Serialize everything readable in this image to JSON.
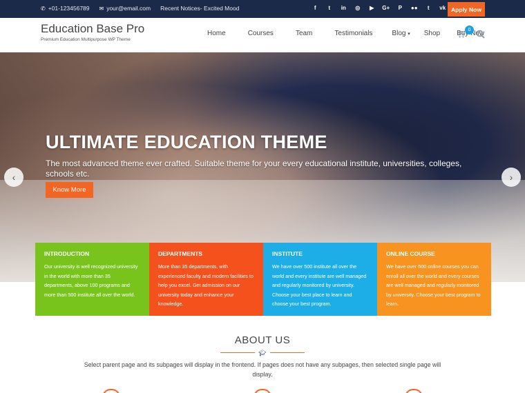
{
  "topbar": {
    "phone": "+01-123456789",
    "email": "your@email.com",
    "notice": "Recent Notices- Excited Mood",
    "social": [
      "facebook-icon",
      "twitter-icon",
      "linkedin-icon",
      "instagram-icon",
      "youtube-icon",
      "google-plus-icon",
      "pinterest-icon",
      "flickr-icon",
      "tumblr-icon",
      "vk-icon"
    ],
    "social_glyphs": [
      "f",
      "t",
      "in",
      "◎",
      "▶",
      "G+",
      "P",
      "●●",
      "t",
      "vk"
    ],
    "apply_label": "Apply Now",
    "colors": {
      "bg": "#1c2a4a",
      "accent": "#f26522"
    }
  },
  "header": {
    "site_title": "Education Base Pro",
    "tagline": "Premium Education Multipurpose WP Theme",
    "nav": [
      "Home",
      "Courses",
      "Team",
      "Testimonials",
      "Blog",
      "Shop",
      "Buy Now"
    ],
    "cart_count": "0"
  },
  "hero": {
    "heading": "ULTIMATE EDUCATION THEME",
    "subtitle": "The most advanced theme ever crafted. Suitable theme for your every educational institute, universities, colleges, schools etc.",
    "button": "Know More"
  },
  "cards": [
    {
      "title": "INTRODUCTION",
      "text": "Our university is well recognized university in the world with more than 35 departments, above 100 programs and more than 500 institute all over the world.",
      "color": "#78c41c"
    },
    {
      "title": "DEPARTMENTS",
      "text": "More than 35 departments, with experienced faculty and modern facilities to help you excel. Get admission on our university today and enhance your knowledge.",
      "color": "#f5511d"
    },
    {
      "title": "INSTITUTE",
      "text": "We have over 500 institute all over the world and every institute are well managed and regularly monitored by university. Choose your best place to learn and choose your best program.",
      "color": "#1daee8"
    },
    {
      "title": "ONLINE COURSE",
      "text": "We have over 500 online courses you can enroll all over the world and every courses are well managed and regularly monitored by university. Choose your best program to learn.",
      "color": "#f7931e"
    }
  ],
  "about": {
    "title": "ABOUT US",
    "text": "Select parent page and its subpages will display in the frontend. If pages does not have any subpages, then selected single page will display."
  }
}
